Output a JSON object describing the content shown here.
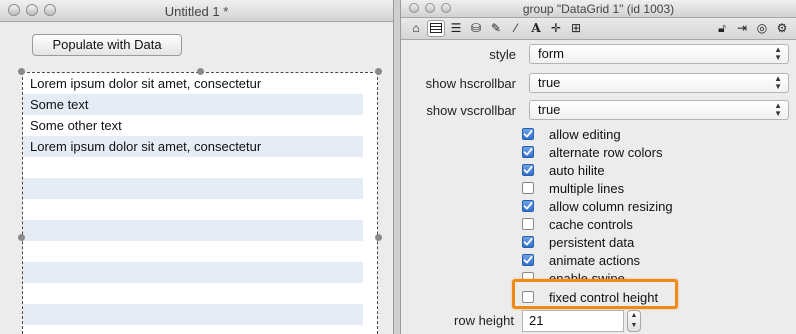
{
  "left_window": {
    "title": "Untitled 1 *",
    "populate_button": "Populate with Data",
    "rows": [
      "Lorem ipsum dolor sit amet, consectetur",
      "Some text",
      "Some other text",
      "Lorem ipsum dolor sit amet, consectetur",
      "",
      "",
      "",
      "",
      "",
      "",
      "",
      "",
      ""
    ]
  },
  "right_window": {
    "title": "group \"DataGrid 1\" (id 1003)",
    "toolbar_icons": [
      "home-icon",
      "datagrid-icon",
      "list-icon",
      "database-icon",
      "pencil-icon",
      "wand-icon",
      "text-icon",
      "move-icon",
      "grid-icon",
      "lock-icon",
      "import-icon",
      "target-icon",
      "gear-icon"
    ],
    "style_label": "style",
    "style_value": "form",
    "hscroll_label": "show hscrollbar",
    "hscroll_value": "true",
    "vscroll_label": "show vscrollbar",
    "vscroll_value": "true",
    "options": [
      {
        "label": "allow editing",
        "checked": true
      },
      {
        "label": "alternate row colors",
        "checked": true
      },
      {
        "label": "auto hilite",
        "checked": true
      },
      {
        "label": "multiple lines",
        "checked": false
      },
      {
        "label": "allow column resizing",
        "checked": true
      },
      {
        "label": "cache controls",
        "checked": false
      },
      {
        "label": "persistent data",
        "checked": true
      },
      {
        "label": "animate actions",
        "checked": true
      },
      {
        "label": "enable swipe",
        "checked": false
      },
      {
        "label": "fixed control height",
        "checked": false
      }
    ],
    "row_height_label": "row height",
    "row_height_value": "21"
  },
  "colors": {
    "alt_row": "#e6ecf6",
    "highlight": "#f08a14",
    "checkbox": "#2f6fd1"
  }
}
